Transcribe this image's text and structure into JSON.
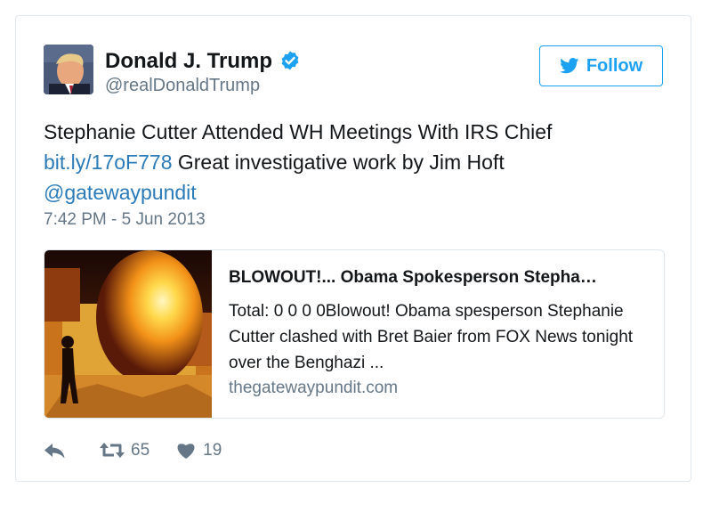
{
  "user": {
    "name": "Donald J. Trump",
    "handle": "@realDonaldTrump"
  },
  "follow_label": "Follow",
  "tweet": {
    "text_line1": "Stephanie Cutter Attended WH Meetings With IRS Chief",
    "link": "bit.ly/17oF778",
    "text_after_link": " Great investigative work by Jim Hoft",
    "mention": "@gatewaypundit",
    "timestamp": "7:42 PM - 5 Jun 2013"
  },
  "link_card": {
    "title": "BLOWOUT!... Obama Spokesperson Stepha…",
    "description": "Total: 0 0 0 0Blowout! Obama spesperson Stephanie Cutter clashed with Bret Baier from FOX News tonight over the Benghazi ...",
    "domain": "thegatewaypundit.com"
  },
  "actions": {
    "retweets": "65",
    "likes": "19"
  },
  "colors": {
    "accent": "#1da1f2",
    "link": "#2b7bb9",
    "muted": "#657786",
    "border": "#e1e8ed"
  },
  "icons": [
    "verified-badge-icon",
    "bird-icon",
    "reply-icon",
    "retweet-icon",
    "heart-icon"
  ]
}
